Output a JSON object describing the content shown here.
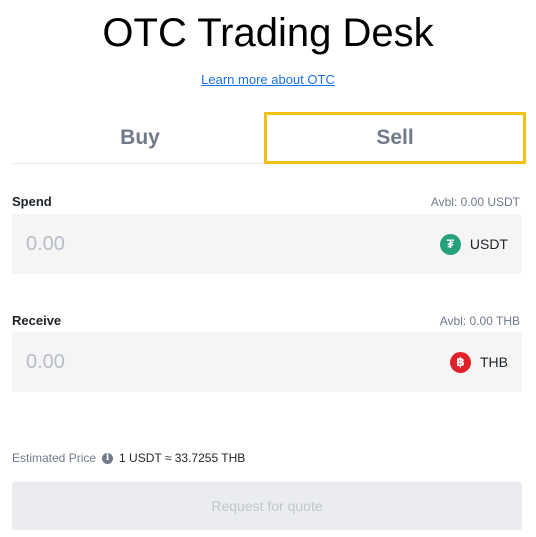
{
  "header": {
    "title": "OTC Trading Desk",
    "learn_link": "Learn more about OTC"
  },
  "tabs": [
    {
      "label": "Buy",
      "active": false
    },
    {
      "label": "Sell",
      "active": true
    }
  ],
  "spend": {
    "label": "Spend",
    "available": "Avbl: 0.00 USDT",
    "placeholder": "0.00",
    "coin": "USDT",
    "coin_icon": "tether-icon",
    "coin_color": "#26a17b"
  },
  "receive": {
    "label": "Receive",
    "available": "Avbl: 0.00 THB",
    "placeholder": "0.00",
    "coin": "THB",
    "coin_icon": "baht-icon",
    "coin_color": "#e0212a"
  },
  "estimate": {
    "label": "Estimated Price",
    "value": "1 USDT ≈ 33.7255 THB"
  },
  "quote_button": {
    "label": "Request for quote",
    "disabled": true
  },
  "colors": {
    "highlight": "#f0c10d",
    "link": "#1a73e8",
    "muted": "#707a8a"
  }
}
